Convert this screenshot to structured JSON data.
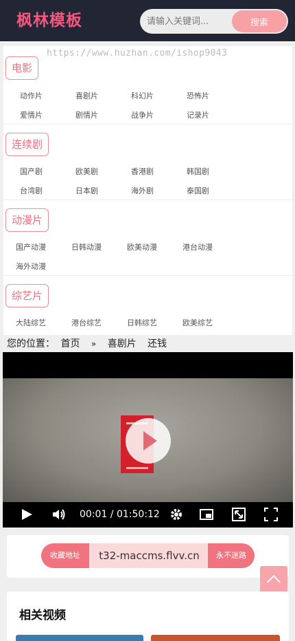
{
  "header": {
    "logo": "枫林模板",
    "search_placeholder": "请输入关键词...",
    "search_button": "搜索"
  },
  "watermark": "https://www.huzhan.com/ishop9043",
  "nav": [
    {
      "title": "电影",
      "links": [
        "动作片",
        "喜剧片",
        "科幻片",
        "恐怖片",
        "爱情片",
        "剧情片",
        "战争片",
        "记录片"
      ]
    },
    {
      "title": "连续剧",
      "links": [
        "国产剧",
        "欧美剧",
        "香港剧",
        "韩国剧",
        "台湾剧",
        "日本剧",
        "海外剧",
        "泰国剧"
      ]
    },
    {
      "title": "动漫片",
      "links": [
        "国产动漫",
        "日韩动漫",
        "欧美动漫",
        "港台动漫",
        "海外动漫"
      ]
    },
    {
      "title": "综艺片",
      "links": [
        "大陆综艺",
        "港台综艺",
        "日韩综艺",
        "欧美综艺"
      ]
    }
  ],
  "breadcrumb": {
    "label": "您的位置：",
    "home": "首页",
    "separator": "»",
    "category": "喜剧片",
    "current": "还钱"
  },
  "player": {
    "time": "00:01 / 01:50:12",
    "progress": 0.0
  },
  "favorite": {
    "label": "收藏地址",
    "domain": "t32-maccms.flvv.cn",
    "tagline": "永不迷路"
  },
  "related": {
    "title": "相关视频"
  },
  "colors": {
    "header_bg": "#222533",
    "accent": "#f06e7f",
    "search_button": "#f7a0a6",
    "back_to_top": "#f8a4ab"
  }
}
